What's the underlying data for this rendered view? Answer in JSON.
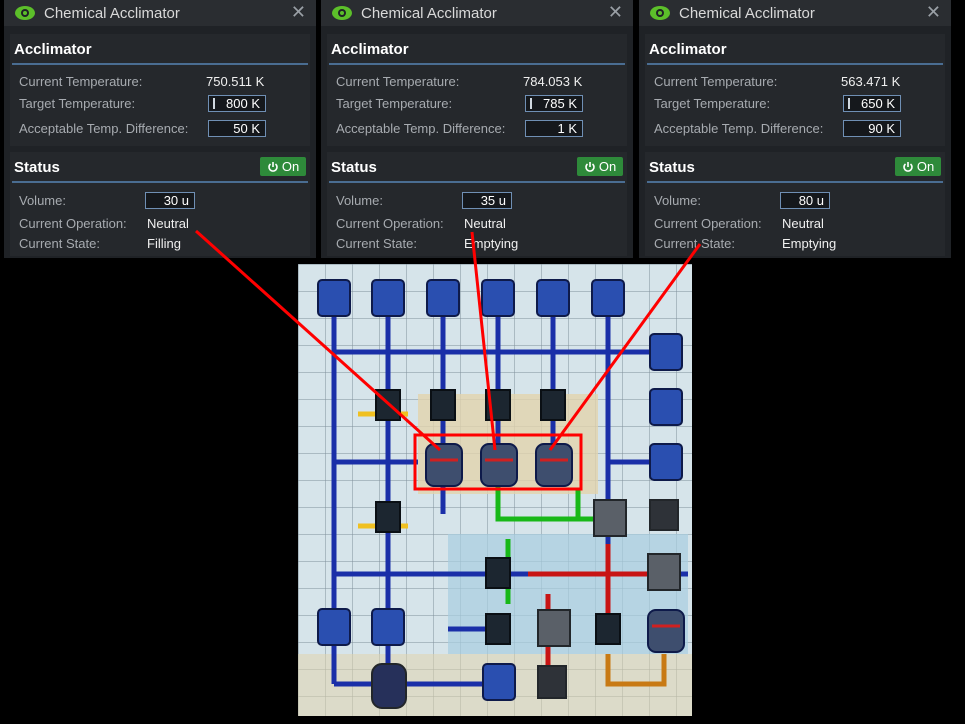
{
  "windows": [
    {
      "title": "Chemical Acclimator",
      "acclimator_header": "Acclimator",
      "current_temperature_label": "Current Temperature:",
      "current_temperature": "750.511 K",
      "target_temperature_label": "Target Temperature:",
      "target_temperature": "800 K",
      "acceptable_diff_label": "Acceptable Temp. Difference:",
      "acceptable_diff": "50 K",
      "status_header": "Status",
      "power_label": "On",
      "volume_label": "Volume:",
      "volume": "30 u",
      "operation_label": "Current Operation:",
      "operation": "Neutral",
      "state_label": "Current State:",
      "state": "Filling"
    },
    {
      "title": "Chemical Acclimator",
      "acclimator_header": "Acclimator",
      "current_temperature_label": "Current Temperature:",
      "current_temperature": "784.053 K",
      "target_temperature_label": "Target Temperature:",
      "target_temperature": "785 K",
      "acceptable_diff_label": "Acceptable Temp. Difference:",
      "acceptable_diff": "1 K",
      "status_header": "Status",
      "power_label": "On",
      "volume_label": "Volume:",
      "volume": "35 u",
      "operation_label": "Current Operation:",
      "operation": "Neutral",
      "state_label": "Current State:",
      "state": "Emptying"
    },
    {
      "title": "Chemical Acclimator",
      "acclimator_header": "Acclimator",
      "current_temperature_label": "Current Temperature:",
      "current_temperature": "563.471 K",
      "target_temperature_label": "Target Temperature:",
      "target_temperature": "650 K",
      "acceptable_diff_label": "Acceptable Temp. Difference:",
      "acceptable_diff": "90 K",
      "status_header": "Status",
      "power_label": "On",
      "volume_label": "Volume:",
      "volume": "80 u",
      "operation_label": "Current Operation:",
      "operation": "Neutral",
      "state_label": "Current State:",
      "state": "Emptying"
    }
  ],
  "colors": {
    "accent_green": "#2e8a3a",
    "pipe_blue": "#1a2fa8",
    "pipe_red": "#c81414",
    "pipe_green": "#18b818",
    "highlight_red": "#ff0000"
  },
  "icons": {
    "visibility": "eye-icon",
    "close": "close-icon",
    "power": "power-icon"
  }
}
